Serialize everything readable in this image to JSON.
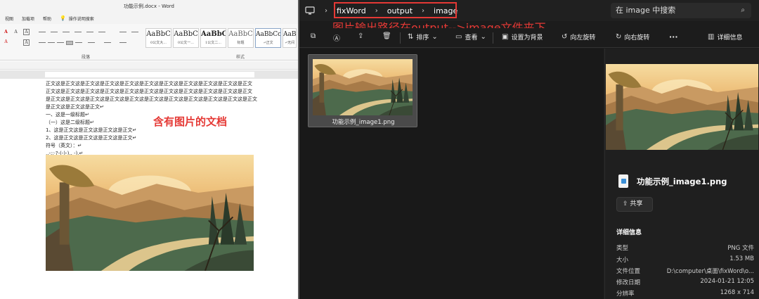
{
  "word": {
    "title": "功能示例.docx  -  Word",
    "menu": [
      "视图",
      "加载项",
      "帮助",
      "操作说明搜索"
    ],
    "style_gallery": [
      {
        "sample": "AaBbC",
        "name": "0公文大..."
      },
      {
        "sample": "AaBbC",
        "name": "0公文一..."
      },
      {
        "sample": "AaBbC",
        "name": "1公文二..."
      },
      {
        "sample": "AaBbC",
        "name": "标题"
      },
      {
        "sample": "AaBbCcl",
        "name": "↵正文"
      },
      {
        "sample": "AaBb",
        "name": "↵无间"
      }
    ],
    "group_paragraph": "段落",
    "group_styles": "样式",
    "body_lines": [
      "正文这是正文这是正文这是正文这是正文这是正文这是正文这是正文这是正文这是正文这是正文",
      "正文这是正文这是正文这是正文这是正文这是正文这是正文这是正文这是正文这是正文这是正文",
      "是正文这是正文这是正文这是正文这是正文这是正文这是正文这是正文这是正文这是正文这是正文",
      "是正文这是正文这是正文↵",
      "一、这是一级标题↵",
      "（一）这是二级标题↵",
      "1、这是正文这是正文这是正文这是正文↵",
      "2、这是正文这是正文这是正文这是正文↵",
      "符号（英文）：↵",
      ",.-:;·?-(-)-),. -),↵"
    ],
    "annotation": "含有图片的文档"
  },
  "explorer": {
    "breadcrumb": [
      "fixWord",
      "output",
      "image"
    ],
    "search_placeholder": "在 image 中搜索",
    "annotation": "图片输出路径在output-->image文件夹下",
    "toolbar": {
      "sort": "排序",
      "view": "查看",
      "set_background": "设置为背景",
      "rotate_left": "向左旋转",
      "rotate_right": "向右旋转",
      "more": "···",
      "details": "详细信息"
    },
    "file": {
      "name": "功能示例_image1.png"
    },
    "details": {
      "file_name": "功能示例_image1.png",
      "share": "共享",
      "section_title": "详细信息",
      "rows": [
        {
          "key": "类型",
          "value": "PNG 文件"
        },
        {
          "key": "大小",
          "value": "1.53 MB"
        },
        {
          "key": "文件位置",
          "value": "D:\\computer\\桌面\\fixWord\\o..."
        },
        {
          "key": "修改日期",
          "value": "2024-01-21 12:05"
        },
        {
          "key": "分辨率",
          "value": "1268 x 714"
        }
      ]
    }
  }
}
